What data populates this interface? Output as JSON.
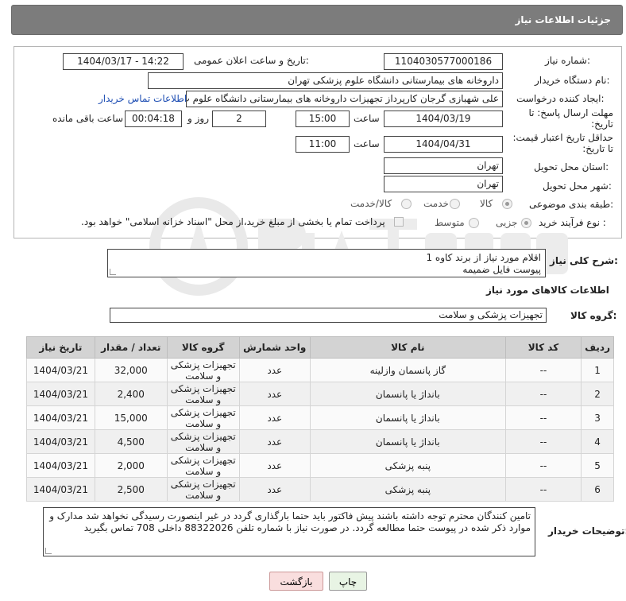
{
  "header": {
    "title": "جزئیات اطلاعات نیاز"
  },
  "form": {
    "need_number_label": "شماره نیاز:",
    "need_number": "1104030577000186",
    "announce_label": "تاریخ و ساعت اعلان عمومی:",
    "announce_value": "1404/03/17 - 14:22",
    "buyer_org_label": "نام دستگاه خریدار:",
    "buyer_org": "داروخانه های بیمارستانی دانشگاه علوم پزشکی تهران",
    "requester_label": "ایجاد کننده درخواست:",
    "requester": "علی شهبازی گرجان کارپرداز تجهیزات داروخانه های بیمارستانی دانشگاه علوم پ",
    "contact_link": "اطلاعات تماس خریدار",
    "reply_deadline_label": "مهلت ارسال پاسخ: تا تاریخ:",
    "reply_date": "1404/03/19",
    "time_label": "ساعت",
    "reply_time": "15:00",
    "days_value": "2",
    "days_label": "روز و",
    "remaining_time": "00:04:18",
    "remaining_label": "ساعت باقی مانده",
    "price_valid_label": "حداقل تاریخ اعتبار قیمت: تا تاریخ:",
    "price_valid_date": "1404/04/31",
    "price_valid_time": "11:00",
    "province_label": "استان محل تحویل:",
    "province": "تهران",
    "city_label": "شهر محل تحویل:",
    "city": "تهران",
    "category_label": "طبقه بندی موضوعی:",
    "category_options": [
      "کالا",
      "خدمت",
      "کالا/خدمت"
    ],
    "category_selected": "کالا",
    "process_label": "نوع فرآیند خرید :",
    "process_options": [
      "جزیی",
      "متوسط"
    ],
    "process_selected": "جزیی",
    "payment_note": "پرداخت تمام یا بخشی از مبلغ خرید،از محل \"اسناد خزانه اسلامی\" خواهد بود."
  },
  "description": {
    "label": "شرح کلی نیاز:",
    "line1": "اقلام مورد نیاز از برند کاوه 1",
    "line2": "پیوست فایل ضمیمه"
  },
  "goods_info": {
    "title": "اطلاعات کالاهای مورد نیاز",
    "group_label": "گروه کالا:",
    "group_value": "تجهیزات پزشکی و سلامت"
  },
  "table": {
    "headers": [
      "ردیف",
      "کد کالا",
      "نام کالا",
      "واحد شمارش",
      "گروه کالا",
      "تعداد / مقدار",
      "تاریخ نیاز"
    ],
    "rows": [
      [
        "1",
        "--",
        "گاز پانسمان وازلینه",
        "عدد",
        "تجهیزات پزشکی و سلامت",
        "32,000",
        "1404/03/21"
      ],
      [
        "2",
        "--",
        "بانداژ یا پانسمان",
        "عدد",
        "تجهیزات پزشکی و سلامت",
        "2,400",
        "1404/03/21"
      ],
      [
        "3",
        "--",
        "بانداژ یا پانسمان",
        "عدد",
        "تجهیزات پزشکی و سلامت",
        "15,000",
        "1404/03/21"
      ],
      [
        "4",
        "--",
        "بانداژ یا پانسمان",
        "عدد",
        "تجهیزات پزشکی و سلامت",
        "4,500",
        "1404/03/21"
      ],
      [
        "5",
        "--",
        "پنبه پزشکی",
        "عدد",
        "تجهیزات پزشکی و سلامت",
        "2,000",
        "1404/03/21"
      ],
      [
        "6",
        "--",
        "پنبه پزشکی",
        "عدد",
        "تجهیزات پزشکی و سلامت",
        "2,500",
        "1404/03/21"
      ]
    ]
  },
  "buyer_notes": {
    "label": "توضیحات خریدار:",
    "text": "تامین کنندگان محترم توجه داشته باشند پیش فاکتور باید حتما بارگذاری گردد در غیر اینصورت رسیدگی نخواهد شد مدارک و موارد ذکر شده در پیوست حتما مطالعه گردد. در صورت نیاز با شماره تلفن 88322026 داخلی 708 تماس بگیرید"
  },
  "buttons": {
    "print": "چاپ",
    "back": "بازگشت"
  },
  "colors": {
    "header_bg": "#7c7c7c",
    "back_button_bg": "#f9dede",
    "print_button_bg": "#e8f4e4",
    "link": "#1f4fb4"
  }
}
